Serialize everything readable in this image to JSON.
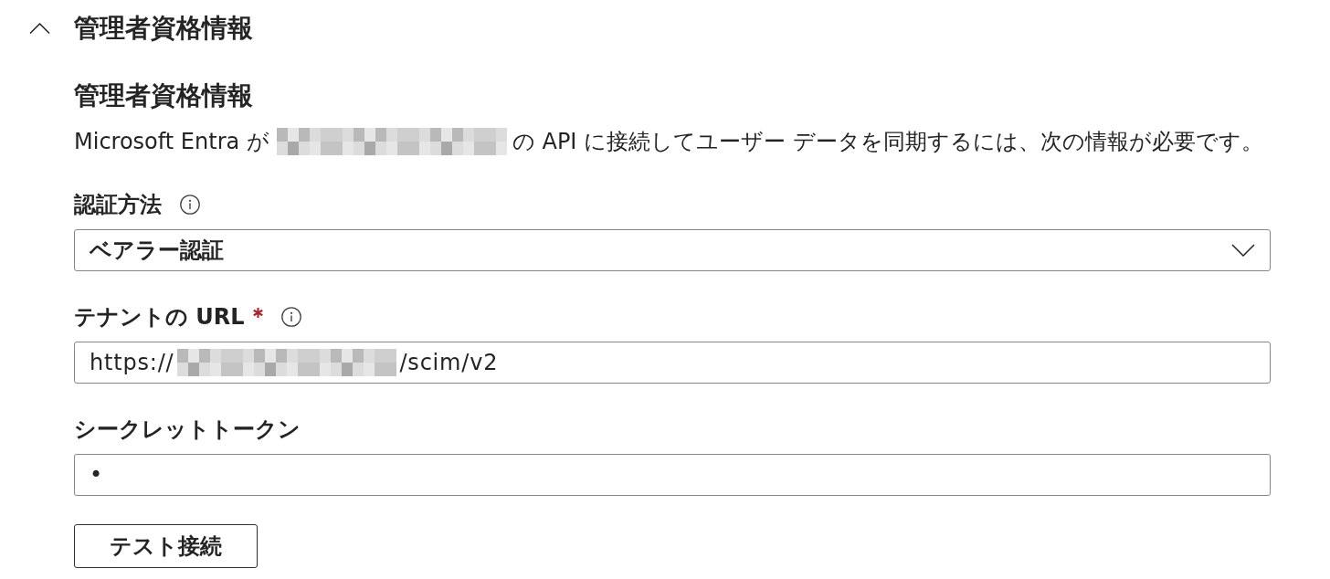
{
  "section": {
    "title": "管理者資格情報",
    "expanded": true
  },
  "credentials": {
    "heading": "管理者資格情報",
    "description": [
      {
        "kind": "text",
        "text": "Microsoft Entra が"
      },
      {
        "kind": "redacted"
      },
      {
        "kind": "text",
        "text": "の API に接続してユーザー データを同期するには、次の情報が必要です。"
      }
    ]
  },
  "fields": [
    {
      "kind": "dropdown",
      "label": "認証方法",
      "required": false,
      "info": true,
      "value": [
        {
          "kind": "text",
          "text": "ベアラー認証"
        }
      ]
    },
    {
      "kind": "text",
      "label": "テナントの URL",
      "required": true,
      "info": true,
      "value": [
        {
          "kind": "text",
          "text": "https://"
        },
        {
          "kind": "redacted"
        },
        {
          "kind": "text",
          "text": "/scim/v2"
        }
      ]
    },
    {
      "kind": "password",
      "label": "シークレットトークン",
      "required": false,
      "info": false,
      "value": [
        {
          "kind": "text",
          "text": "•"
        }
      ]
    }
  ],
  "button": {
    "label": "テスト接続"
  }
}
